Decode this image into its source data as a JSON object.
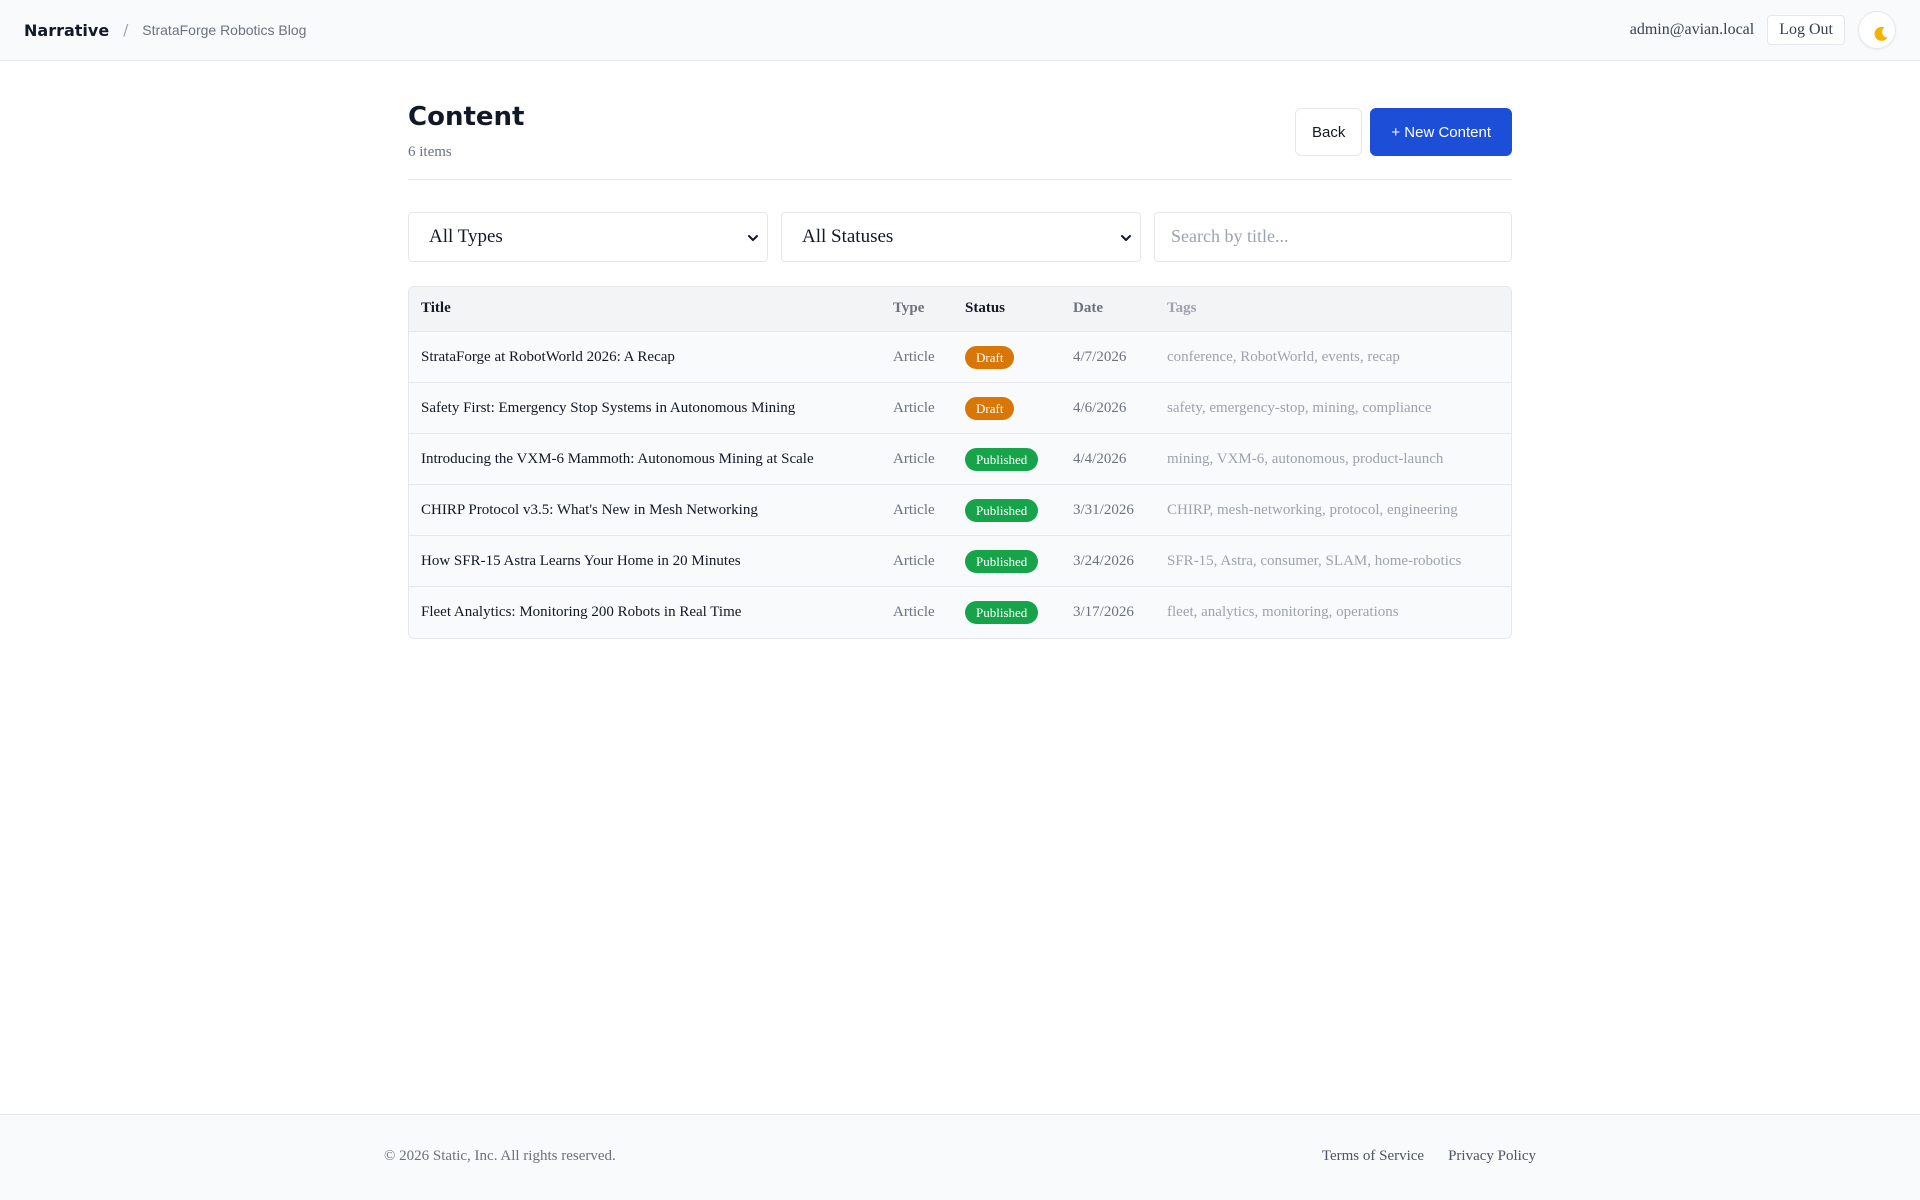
{
  "header": {
    "brand": "Narrative",
    "separator": "/",
    "site_name": "StrataForge Robotics Blog",
    "user_email": "admin@avian.local",
    "logout_label": "Log Out",
    "theme_icon": "moon-icon"
  },
  "page": {
    "title": "Content",
    "item_count": "6 items",
    "back_label": "Back",
    "new_label": "+ New Content"
  },
  "filters": {
    "type_selected": "All Types",
    "status_selected": "All Statuses",
    "search_placeholder": "Search by title...",
    "search_value": ""
  },
  "table": {
    "columns": [
      "Title",
      "Type",
      "Status",
      "Date",
      "Tags"
    ],
    "rows": [
      {
        "title": "StrataForge at RobotWorld 2026: A Recap",
        "type": "Article",
        "status": "Draft",
        "date": "4/7/2026",
        "tags": "conference, RobotWorld, events, recap"
      },
      {
        "title": "Safety First: Emergency Stop Systems in Autonomous Mining",
        "type": "Article",
        "status": "Draft",
        "date": "4/6/2026",
        "tags": "safety, emergency-stop, mining, compliance"
      },
      {
        "title": "Introducing the VXM-6 Mammoth: Autonomous Mining at Scale",
        "type": "Article",
        "status": "Published",
        "date": "4/4/2026",
        "tags": "mining, VXM-6, autonomous, product-launch"
      },
      {
        "title": "CHIRP Protocol v3.5: What's New in Mesh Networking",
        "type": "Article",
        "status": "Published",
        "date": "3/31/2026",
        "tags": "CHIRP, mesh-networking, protocol, engineering"
      },
      {
        "title": "How SFR-15 Astra Learns Your Home in 20 Minutes",
        "type": "Article",
        "status": "Published",
        "date": "3/24/2026",
        "tags": "SFR-15, Astra, consumer, SLAM, home-robotics"
      },
      {
        "title": "Fleet Analytics: Monitoring 200 Robots in Real Time",
        "type": "Article",
        "status": "Published",
        "date": "3/17/2026",
        "tags": "fleet, analytics, monitoring, operations"
      }
    ]
  },
  "status_colors": {
    "Draft": "#d97706",
    "Published": "#16a34a"
  },
  "colors": {
    "accent": "#1d4ed8"
  },
  "footer": {
    "copyright": "© 2026 Static, Inc. All rights reserved.",
    "terms": "Terms of Service",
    "privacy": "Privacy Policy"
  }
}
